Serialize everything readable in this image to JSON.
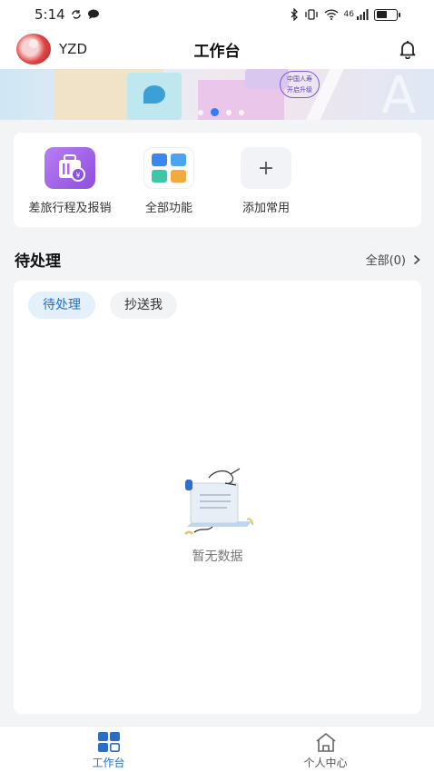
{
  "status_bar": {
    "time": "5:14",
    "signal_text": "46",
    "battery_level": 0.55
  },
  "header": {
    "username": "YZD",
    "title": "工作台"
  },
  "banner": {
    "tag_line1": "中国人寿",
    "tag_line2": "开启升级",
    "big_letter": "A",
    "current_slide": 2,
    "slide_count": 4
  },
  "quick_actions": [
    {
      "label": "差旅行程及报销",
      "icon": "luggage-icon"
    },
    {
      "label": "全部功能",
      "icon": "grid-icon"
    },
    {
      "label": "添加常用",
      "icon": "plus-icon",
      "glyph": "+"
    }
  ],
  "todo_section": {
    "title": "待处理",
    "more_label": "全部(0)",
    "tabs": [
      {
        "label": "待处理",
        "active": true
      },
      {
        "label": "抄送我",
        "active": false
      }
    ],
    "empty_text": "暂无数据"
  },
  "bottom_nav": [
    {
      "label": "工作台",
      "icon": "workbench-icon",
      "active": true
    },
    {
      "label": "个人中心",
      "icon": "home-icon",
      "active": false
    }
  ],
  "colors": {
    "accent": "#2a6fc4",
    "tab_active_bg": "#e4f0fb",
    "travel_icon": "#9b5ee6"
  }
}
